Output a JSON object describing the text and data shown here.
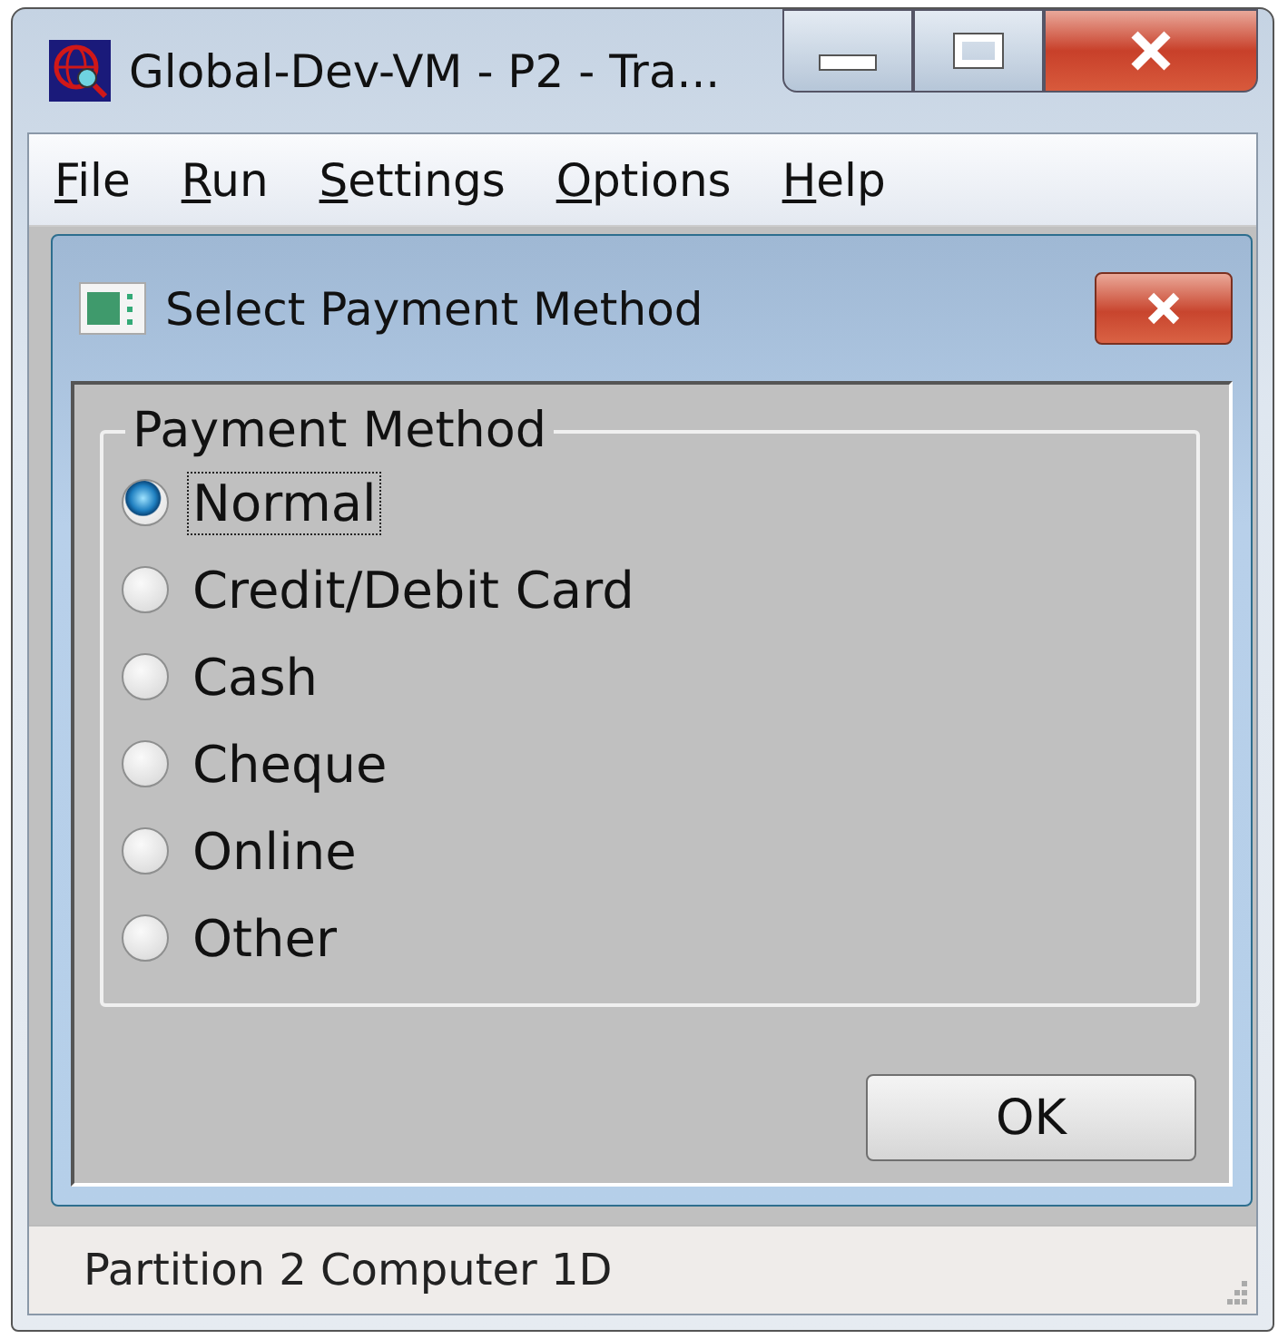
{
  "window": {
    "title": "Global-Dev-VM - P2 - Tra..."
  },
  "menu": [
    {
      "label": "File"
    },
    {
      "label": "Run"
    },
    {
      "label": "Settings"
    },
    {
      "label": "Options"
    },
    {
      "label": "Help"
    }
  ],
  "dialog": {
    "title": "Select Payment Method",
    "group": "Payment Method",
    "options": [
      {
        "label": "Normal",
        "selected": true
      },
      {
        "label": "Credit/Debit Card",
        "selected": false
      },
      {
        "label": "Cash",
        "selected": false
      },
      {
        "label": "Cheque",
        "selected": false
      },
      {
        "label": "Online",
        "selected": false
      },
      {
        "label": "Other",
        "selected": false
      }
    ],
    "buttons": [
      "OK"
    ]
  },
  "status_bar": "Partition 2 Computer 1D"
}
